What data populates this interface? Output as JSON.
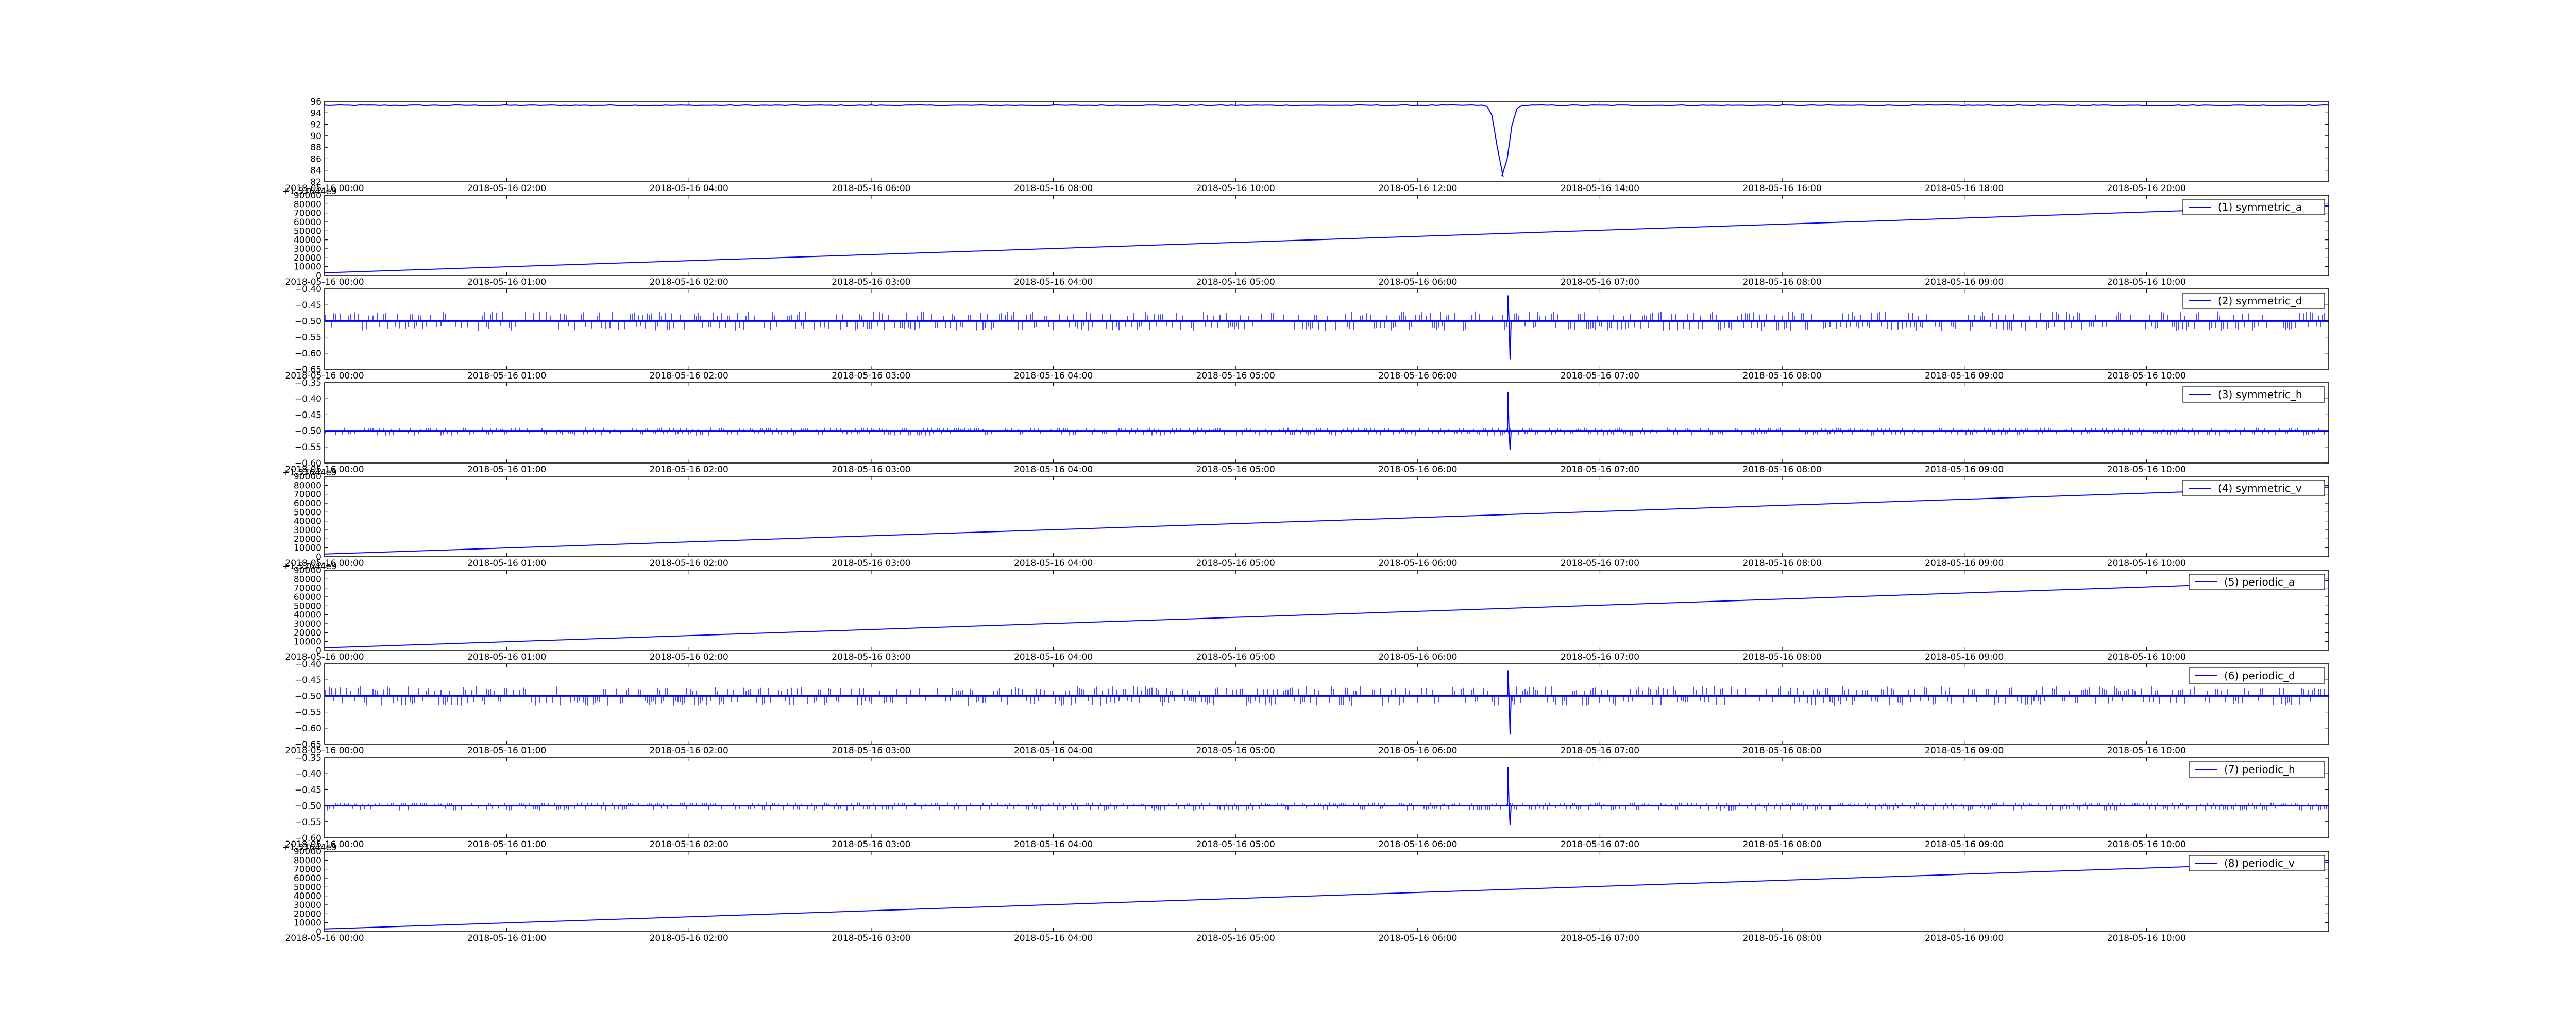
{
  "figure": {
    "background": "#ffffff",
    "line_color": "#0000ff",
    "axis_color": "#000000"
  },
  "chart_data": [
    {
      "type": "line",
      "legend": "",
      "ylim": [
        82,
        96
      ],
      "yticks": [
        "82",
        "84",
        "86",
        "88",
        "90",
        "92",
        "94",
        "96"
      ],
      "xticks": [
        "2018-05-16 00:00",
        "2018-05-16 02:00",
        "2018-05-16 04:00",
        "2018-05-16 06:00",
        "2018-05-16 08:00",
        "2018-05-16 10:00",
        "2018-05-16 12:00",
        "2018-05-16 14:00",
        "2018-05-16 16:00",
        "2018-05-16 18:00",
        "2018-05-16 20:00"
      ],
      "offset_text": "",
      "signal": "dip",
      "baseline": 95.4,
      "dip_min": 83,
      "dip_at_fraction": 0.588
    },
    {
      "type": "line",
      "legend": "(1) symmetric_a",
      "ylim": [
        0,
        90000
      ],
      "yticks": [
        "0",
        "10000",
        "20000",
        "30000",
        "40000",
        "50000",
        "60000",
        "70000",
        "80000",
        "90000"
      ],
      "xticks": [
        "2018-05-16 00:00",
        "2018-05-16 01:00",
        "2018-05-16 02:00",
        "2018-05-16 03:00",
        "2018-05-16 04:00",
        "2018-05-16 05:00",
        "2018-05-16 06:00",
        "2018-05-16 07:00",
        "2018-05-16 08:00",
        "2018-05-16 09:00",
        "2018-05-16 10:00"
      ],
      "offset_text": "+1.52644e9",
      "signal": "ramp",
      "y_start": 3000,
      "y_end": 78000
    },
    {
      "type": "line",
      "legend": "(2) symmetric_d",
      "ylim": [
        -0.65,
        -0.4
      ],
      "yticks": [
        "−0.65",
        "−0.60",
        "−0.55",
        "−0.50",
        "−0.45",
        "−0.40"
      ],
      "xticks": [
        "2018-05-16 00:00",
        "2018-05-16 01:00",
        "2018-05-16 02:00",
        "2018-05-16 03:00",
        "2018-05-16 04:00",
        "2018-05-16 05:00",
        "2018-05-16 06:00",
        "2018-05-16 07:00",
        "2018-05-16 08:00",
        "2018-05-16 09:00",
        "2018-05-16 10:00"
      ],
      "offset_text": "",
      "signal": "spikes",
      "baseline": -0.5,
      "spike_up": -0.47,
      "spike_down": -0.53,
      "burst_max": -0.42,
      "burst_min": -0.62,
      "burst_at_fraction": 0.591
    },
    {
      "type": "line",
      "legend": "(3) symmetric_h",
      "ylim": [
        -0.6,
        -0.35
      ],
      "yticks": [
        "−0.60",
        "−0.55",
        "−0.50",
        "−0.45",
        "−0.40",
        "−0.35"
      ],
      "xticks": [
        "2018-05-16 00:00",
        "2018-05-16 01:00",
        "2018-05-16 02:00",
        "2018-05-16 03:00",
        "2018-05-16 04:00",
        "2018-05-16 05:00",
        "2018-05-16 06:00",
        "2018-05-16 07:00",
        "2018-05-16 08:00",
        "2018-05-16 09:00",
        "2018-05-16 10:00"
      ],
      "offset_text": "",
      "signal": "spikes",
      "baseline": -0.5,
      "spike_up": -0.49,
      "spike_down": -0.515,
      "burst_max": -0.38,
      "burst_min": -0.56,
      "burst_at_fraction": 0.591
    },
    {
      "type": "line",
      "legend": "(4) symmetric_v",
      "ylim": [
        0,
        90000
      ],
      "yticks": [
        "0",
        "10000",
        "20000",
        "30000",
        "40000",
        "50000",
        "60000",
        "70000",
        "80000",
        "90000"
      ],
      "xticks": [
        "2018-05-16 00:00",
        "2018-05-16 01:00",
        "2018-05-16 02:00",
        "2018-05-16 03:00",
        "2018-05-16 04:00",
        "2018-05-16 05:00",
        "2018-05-16 06:00",
        "2018-05-16 07:00",
        "2018-05-16 08:00",
        "2018-05-16 09:00",
        "2018-05-16 10:00"
      ],
      "offset_text": "+1.52644e9",
      "signal": "ramp",
      "y_start": 3000,
      "y_end": 78000
    },
    {
      "type": "line",
      "legend": "(5) periodic_a",
      "ylim": [
        0,
        90000
      ],
      "yticks": [
        "0",
        "10000",
        "20000",
        "30000",
        "40000",
        "50000",
        "60000",
        "70000",
        "80000",
        "90000"
      ],
      "xticks": [
        "2018-05-16 00:00",
        "2018-05-16 01:00",
        "2018-05-16 02:00",
        "2018-05-16 03:00",
        "2018-05-16 04:00",
        "2018-05-16 05:00",
        "2018-05-16 06:00",
        "2018-05-16 07:00",
        "2018-05-16 08:00",
        "2018-05-16 09:00",
        "2018-05-16 10:00"
      ],
      "offset_text": "+1.52644e9",
      "signal": "ramp",
      "y_start": 3000,
      "y_end": 78000
    },
    {
      "type": "line",
      "legend": "(6) periodic_d",
      "ylim": [
        -0.65,
        -0.4
      ],
      "yticks": [
        "−0.65",
        "−0.60",
        "−0.55",
        "−0.50",
        "−0.45",
        "−0.40"
      ],
      "xticks": [
        "2018-05-16 00:00",
        "2018-05-16 01:00",
        "2018-05-16 02:00",
        "2018-05-16 03:00",
        "2018-05-16 04:00",
        "2018-05-16 05:00",
        "2018-05-16 06:00",
        "2018-05-16 07:00",
        "2018-05-16 08:00",
        "2018-05-16 09:00",
        "2018-05-16 10:00"
      ],
      "offset_text": "",
      "signal": "spikes",
      "baseline": -0.5,
      "spike_up": -0.47,
      "spike_down": -0.53,
      "burst_max": -0.42,
      "burst_min": -0.62,
      "burst_at_fraction": 0.591
    },
    {
      "type": "line",
      "legend": "(7) periodic_h",
      "ylim": [
        -0.6,
        -0.35
      ],
      "yticks": [
        "−0.60",
        "−0.55",
        "−0.50",
        "−0.45",
        "−0.40",
        "−0.35"
      ],
      "xticks": [
        "2018-05-16 00:00",
        "2018-05-16 01:00",
        "2018-05-16 02:00",
        "2018-05-16 03:00",
        "2018-05-16 04:00",
        "2018-05-16 05:00",
        "2018-05-16 06:00",
        "2018-05-16 07:00",
        "2018-05-16 08:00",
        "2018-05-16 09:00",
        "2018-05-16 10:00"
      ],
      "offset_text": "",
      "signal": "spikes",
      "baseline": -0.5,
      "spike_up": -0.49,
      "spike_down": -0.515,
      "burst_max": -0.38,
      "burst_min": -0.56,
      "burst_at_fraction": 0.591
    },
    {
      "type": "line",
      "legend": "(8) periodic_v",
      "ylim": [
        0,
        90000
      ],
      "yticks": [
        "0",
        "10000",
        "20000",
        "30000",
        "40000",
        "50000",
        "60000",
        "70000",
        "80000",
        "90000"
      ],
      "xticks": [
        "2018-05-16 00:00",
        "2018-05-16 01:00",
        "2018-05-16 02:00",
        "2018-05-16 03:00",
        "2018-05-16 04:00",
        "2018-05-16 05:00",
        "2018-05-16 06:00",
        "2018-05-16 07:00",
        "2018-05-16 08:00",
        "2018-05-16 09:00",
        "2018-05-16 10:00"
      ],
      "offset_text": "+1.52644e9",
      "signal": "ramp",
      "y_start": 3000,
      "y_end": 78000
    }
  ]
}
